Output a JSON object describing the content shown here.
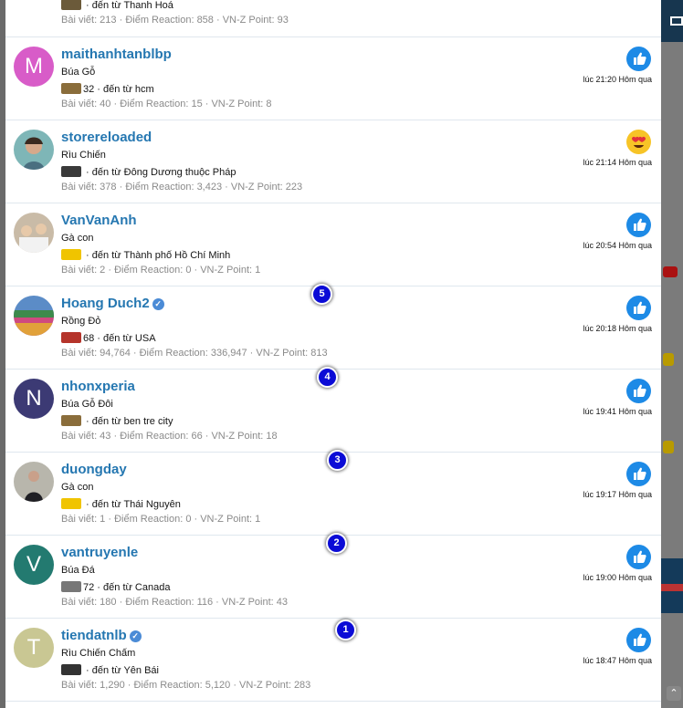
{
  "rows": [
    {
      "name": "",
      "title": "",
      "rank_count": "",
      "location": "đến từ Thanh Hoá",
      "stats": "Bài viết: 213 · Điểm Reaction: 858 · VN-Z Point: 93",
      "time": "",
      "reaction": "like",
      "avatar_letter": ""
    },
    {
      "name": "maithanhtanblbp",
      "title": "Búa Gỗ",
      "rank_count": "32",
      "location": "đến từ hcm",
      "stats": "Bài viết: 40 · Điểm Reaction: 15 · VN-Z Point: 8",
      "time": "lúc 21:20 Hôm qua",
      "reaction": "like",
      "avatar_letter": "M",
      "avatar_color": "#d85cc8"
    },
    {
      "name": "storereloaded",
      "title": "Rìu Chiến",
      "rank_count": "",
      "location": "đến từ Đông Dương thuộc Pháp",
      "stats": "Bài viết: 378 · Điểm Reaction: 3,423 · VN-Z Point: 223",
      "time": "lúc 21:14 Hôm qua",
      "reaction": "love",
      "avatar_letter": ""
    },
    {
      "name": "VanVanAnh",
      "title": "Gà con",
      "rank_count": "",
      "location": "đến từ Thành phố Hồ Chí Minh",
      "stats": "Bài viết: 2 · Điểm Reaction: 0 · VN-Z Point: 1",
      "time": "lúc 20:54 Hôm qua",
      "reaction": "like",
      "avatar_letter": ""
    },
    {
      "name": "Hoang Duch2",
      "verified": true,
      "title": "Rồng Đỏ",
      "rank_count": "68",
      "location": "đến từ USA",
      "stats": "Bài viết: 94,764 · Điểm Reaction: 336,947 · VN-Z Point: 813",
      "time": "lúc 20:18 Hôm qua",
      "reaction": "like",
      "avatar_letter": "",
      "marker": "5"
    },
    {
      "name": "nhonxperia",
      "title": "Búa Gỗ Đôi",
      "rank_count": "",
      "location": "đến từ ben tre city",
      "stats": "Bài viết: 43 · Điểm Reaction: 66 · VN-Z Point: 18",
      "time": "lúc 19:41 Hôm qua",
      "reaction": "like",
      "avatar_letter": "N",
      "avatar_color": "#3c3a74",
      "marker": "4"
    },
    {
      "name": "duongday",
      "title": "Gà con",
      "rank_count": "",
      "location": "đến từ Thái Nguyên",
      "stats": "Bài viết: 1 · Điểm Reaction: 0 · VN-Z Point: 1",
      "time": "lúc 19:17 Hôm qua",
      "reaction": "like",
      "avatar_letter": "",
      "marker": "3"
    },
    {
      "name": "vantruyenle",
      "title": "Búa Đá",
      "rank_count": "72",
      "location": "đến từ Canada",
      "stats": "Bài viết: 180 · Điểm Reaction: 116 · VN-Z Point: 43",
      "time": "lúc 19:00 Hôm qua",
      "reaction": "like",
      "avatar_letter": "V",
      "avatar_color": "#237a70",
      "marker": "2"
    },
    {
      "name": "tiendatnlb",
      "verified": true,
      "title": "Rìu Chiến Chấm",
      "rank_count": "",
      "location": "đến từ Yên Bái",
      "stats": "Bài viết: 1,290 · Điểm Reaction: 5,120 · VN-Z Point: 283",
      "time": "lúc 18:47 Hôm qua",
      "reaction": "like",
      "avatar_letter": "T",
      "avatar_color": "#c9c793",
      "marker": "1"
    }
  ],
  "colors": {
    "username": "#2577b1",
    "like": "#1d8ae6",
    "marker": "#0b0bd6",
    "header_dark": "#17364f"
  },
  "icons": {
    "like": "thumbs-up-icon",
    "love": "heart-eyes-emoji-icon",
    "verified": "verified-check-icon",
    "rank": "rank-badge-icon"
  }
}
